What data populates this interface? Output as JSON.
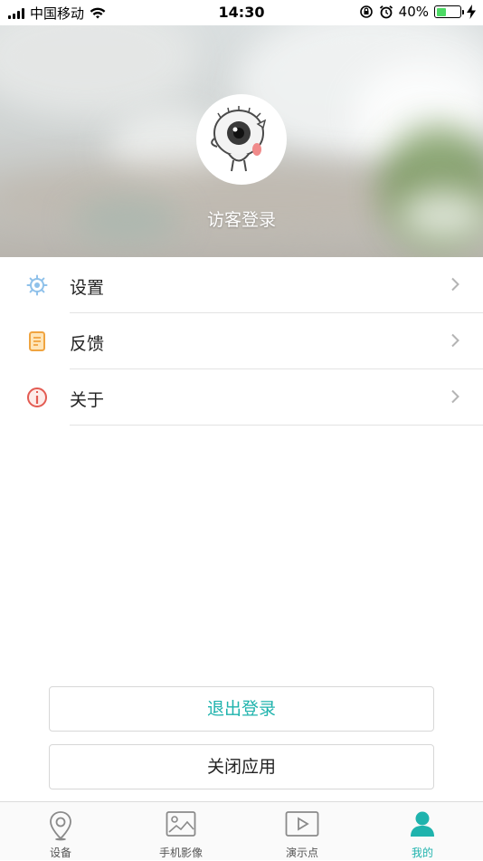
{
  "status_bar": {
    "carrier": "中国移动",
    "time": "14:30",
    "battery_percent": "40%",
    "battery_level": 0.4,
    "battery_color": "#4cd964"
  },
  "profile": {
    "name": "访客登录",
    "avatar_icon": "cartoon-eye-mascot"
  },
  "menu": [
    {
      "label": "设置",
      "icon": "settings-gear-icon",
      "color": "#8fc1ea"
    },
    {
      "label": "反馈",
      "icon": "feedback-document-icon",
      "color": "#f0a440"
    },
    {
      "label": "关于",
      "icon": "about-info-icon",
      "color": "#e35b52"
    }
  ],
  "buttons": {
    "logout": "退出登录",
    "close_app": "关闭应用"
  },
  "tabbar": {
    "items": [
      {
        "label": "设备",
        "icon": "location-pin-icon"
      },
      {
        "label": "手机影像",
        "icon": "image-icon"
      },
      {
        "label": "演示点",
        "icon": "play-icon"
      },
      {
        "label": "我的",
        "icon": "person-icon",
        "active": true
      }
    ],
    "active_color": "#1fb3ad"
  }
}
